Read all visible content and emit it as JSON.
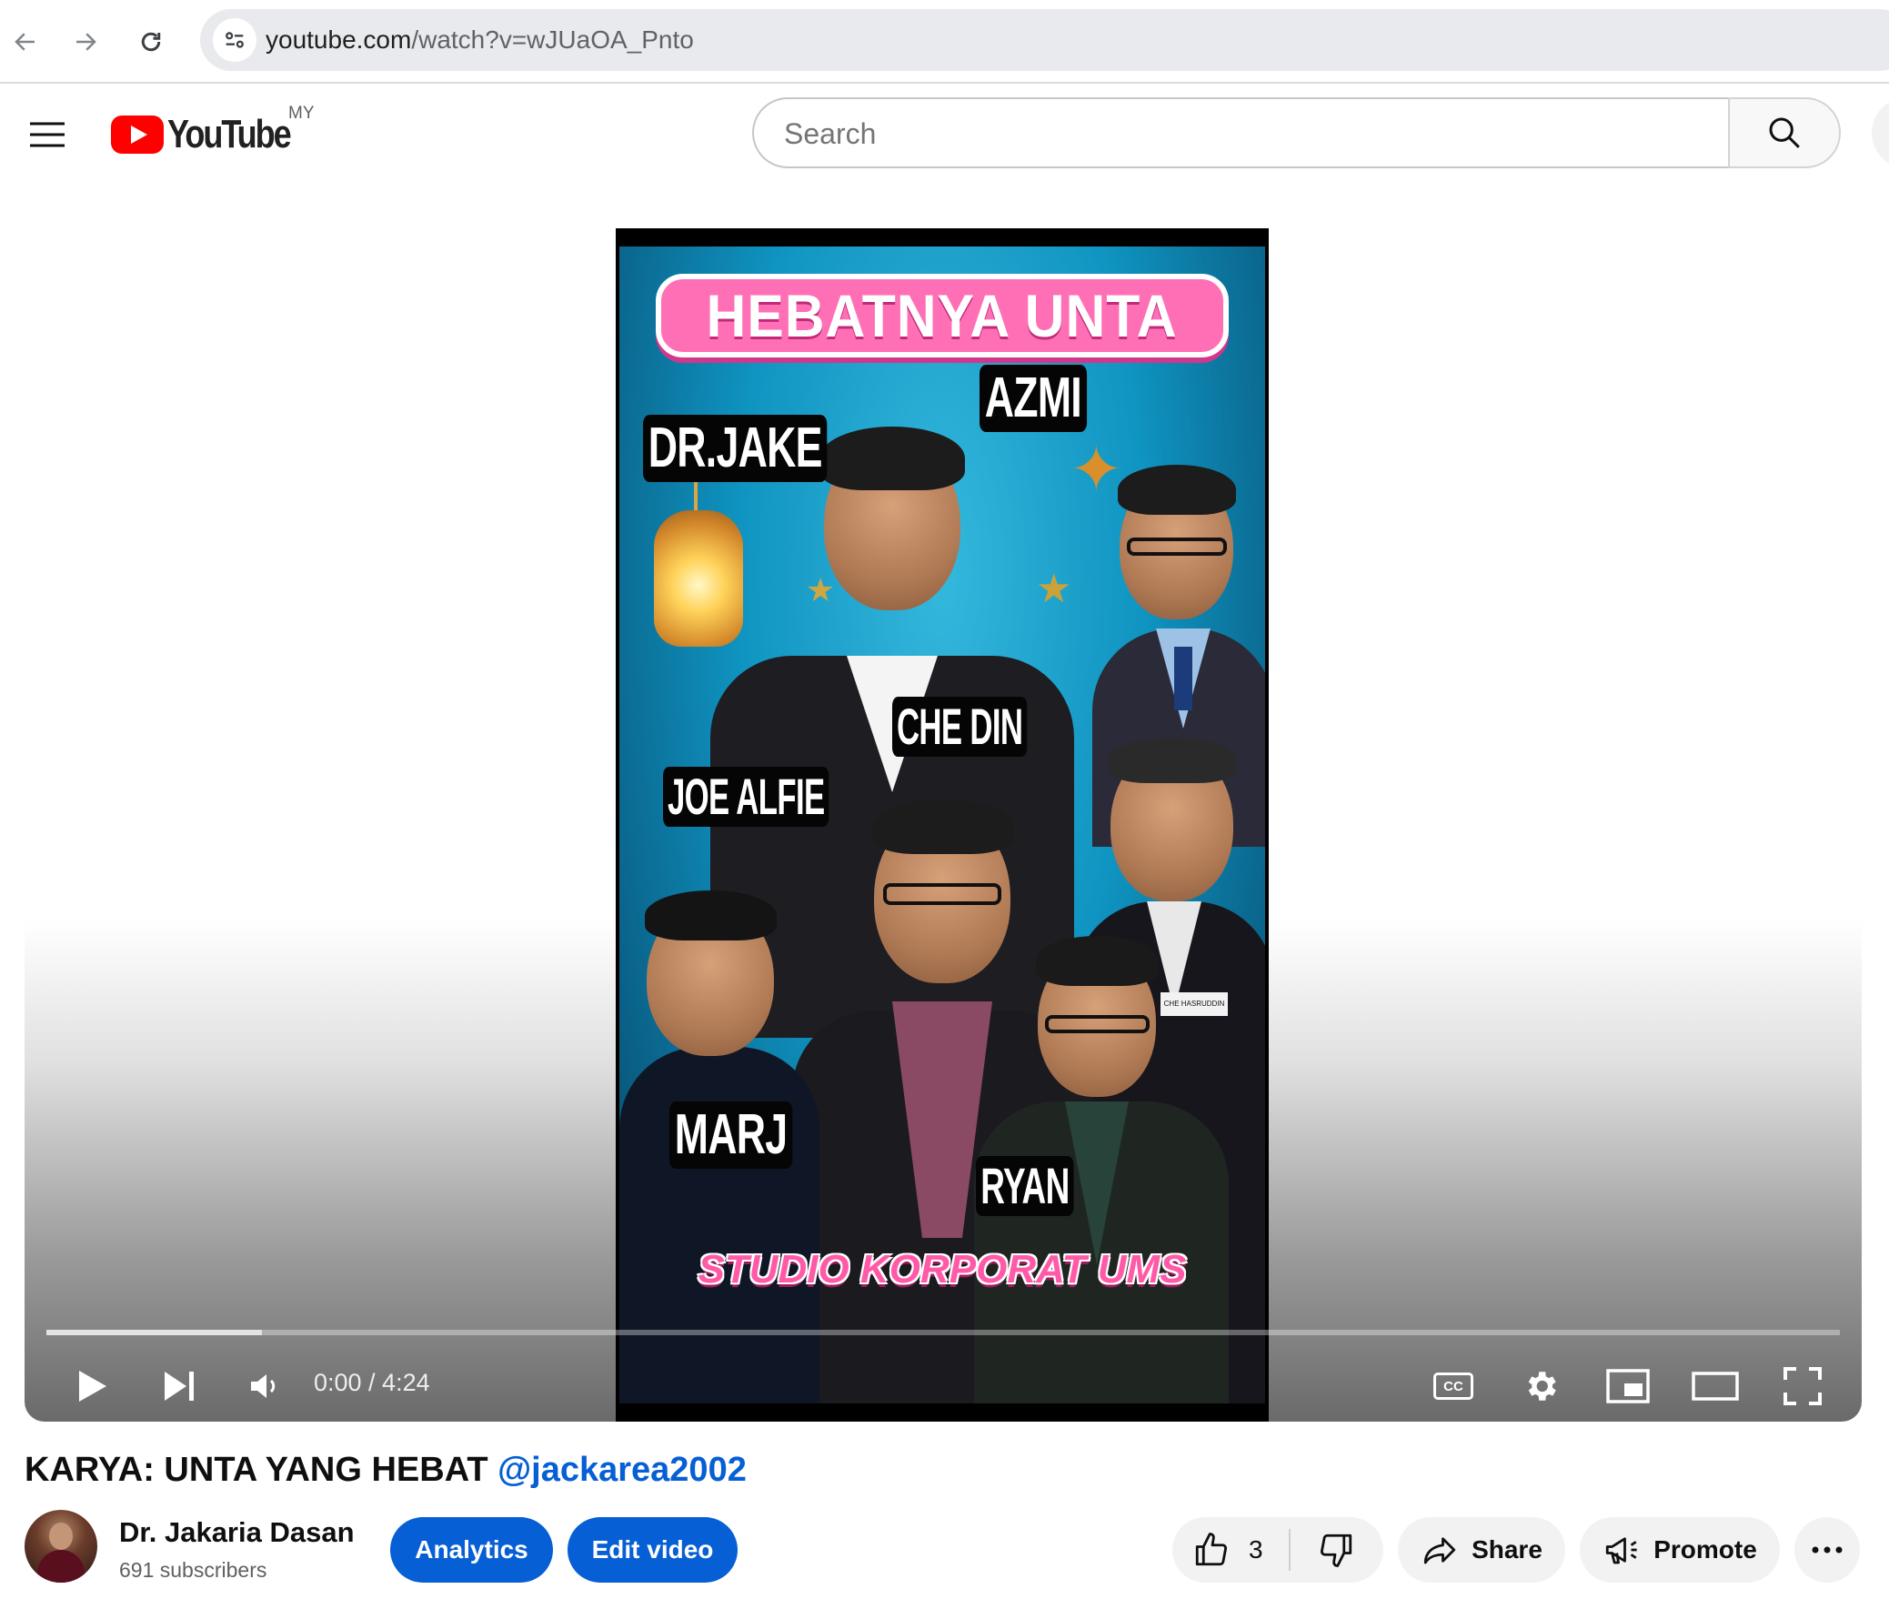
{
  "browser": {
    "url_host": "youtube.com",
    "url_path": "/watch?v=wJUaOA_Pnto",
    "icons": [
      "back-arrow-icon",
      "forward-arrow-icon",
      "reload-icon",
      "site-settings-icon"
    ]
  },
  "masthead": {
    "logo_text": "YouTube",
    "country_code": "MY",
    "search_placeholder": "Search",
    "search_value": "",
    "icons": [
      "hamburger-menu-icon",
      "search-icon"
    ]
  },
  "video": {
    "thumbnail": {
      "title": "HEBATNYA UNTA",
      "names": [
        "DR.JAKE",
        "AZMI",
        "CHE DIN",
        "JOE ALFIE",
        "MARJ",
        "RYAN"
      ],
      "studio": "STUDIO KORPORAT UMS",
      "badge_text": "CHE HASRUDDIN"
    },
    "player": {
      "current_time": "0:00",
      "duration": "4:24",
      "time_display": "0:00 / 4:24",
      "buffered_fraction": 0.12,
      "subtitles_label": "CC",
      "icons": [
        "play-icon",
        "next-icon",
        "volume-icon",
        "subtitles-icon",
        "settings-gear-icon",
        "miniplayer-icon",
        "theater-mode-icon",
        "fullscreen-icon"
      ]
    }
  },
  "meta": {
    "title_text": "KARYA: UNTA YANG HEBAT",
    "title_mention": "@jackarea2002",
    "channel_name": "Dr. Jakaria Dasan",
    "subscribers": "691 subscribers",
    "analytics_label": "Analytics",
    "edit_label": "Edit video",
    "like_count": "3",
    "share_label": "Share",
    "promote_label": "Promote",
    "icons": [
      "thumbs-up-icon",
      "thumbs-down-icon",
      "share-arrow-icon",
      "megaphone-icon",
      "more-options-icon"
    ]
  },
  "colors": {
    "youtube_red": "#ff0000",
    "link_blue": "#065fd4",
    "button_blue": "#065fd4",
    "pill_grey": "#f2f2f2",
    "banner_pink": "#ff6fb5"
  }
}
